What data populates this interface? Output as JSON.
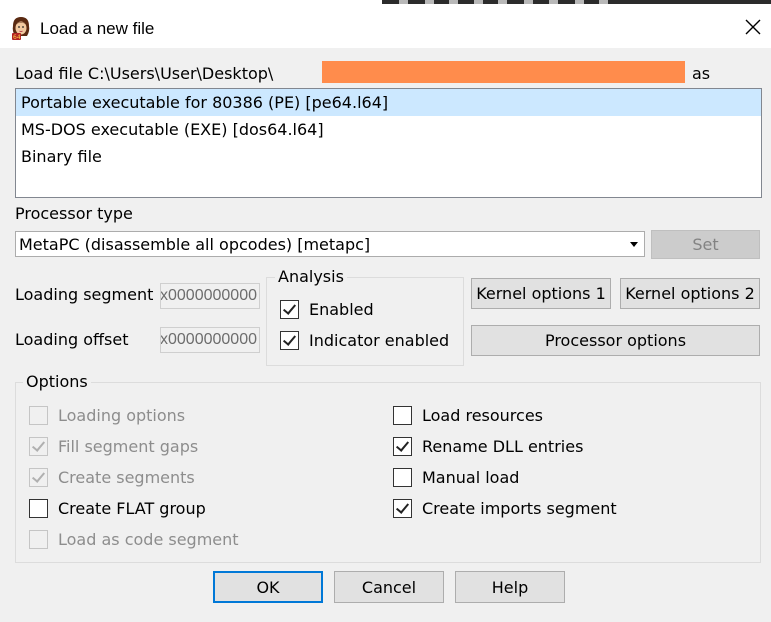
{
  "window": {
    "title": "Load a new file",
    "close_icon": "close-icon",
    "app_icon": "ida-pro-icon"
  },
  "load_file": {
    "prefix": "Load file C:\\Users\\User\\Desktop\\",
    "suffix": "as"
  },
  "file_types": [
    {
      "label": "Portable executable for 80386 (PE) [pe64.l64]",
      "selected": true
    },
    {
      "label": "MS-DOS executable (EXE) [dos64.l64]",
      "selected": false
    },
    {
      "label": "Binary file",
      "selected": false
    }
  ],
  "processor": {
    "label": "Processor type",
    "selected": "MetaPC (disassemble all opcodes) [metapc]",
    "set_label": "Set"
  },
  "loading": {
    "segment_label": "Loading segment",
    "segment_value": "0x0000000000",
    "offset_label": "Loading offset",
    "offset_value": "0x0000000000"
  },
  "analysis": {
    "title": "Analysis",
    "enabled_label": "Enabled",
    "enabled_checked": true,
    "indicator_label": "Indicator enabled",
    "indicator_checked": true
  },
  "buttons": {
    "kernel1": "Kernel options 1",
    "kernel2": "Kernel options 2",
    "processor_options": "Processor options",
    "ok": "OK",
    "cancel": "Cancel",
    "help": "Help"
  },
  "options": {
    "title": "Options",
    "left": [
      {
        "label": "Loading options",
        "checked": false,
        "enabled": false
      },
      {
        "label": "Fill segment gaps",
        "checked": true,
        "enabled": false
      },
      {
        "label": "Create segments",
        "checked": true,
        "enabled": false
      },
      {
        "label": "Create FLAT group",
        "checked": false,
        "enabled": true
      },
      {
        "label": "Load as code segment",
        "checked": false,
        "enabled": false
      }
    ],
    "right": [
      {
        "label": "Load resources",
        "checked": false,
        "enabled": true
      },
      {
        "label": "Rename DLL entries",
        "checked": true,
        "enabled": true
      },
      {
        "label": "Manual load",
        "checked": false,
        "enabled": true
      },
      {
        "label": "Create imports segment",
        "checked": true,
        "enabled": true
      }
    ]
  },
  "colors": {
    "redaction": "#ff8c4c",
    "selection": "#cce8ff",
    "default_button_border": "#0078d7"
  }
}
